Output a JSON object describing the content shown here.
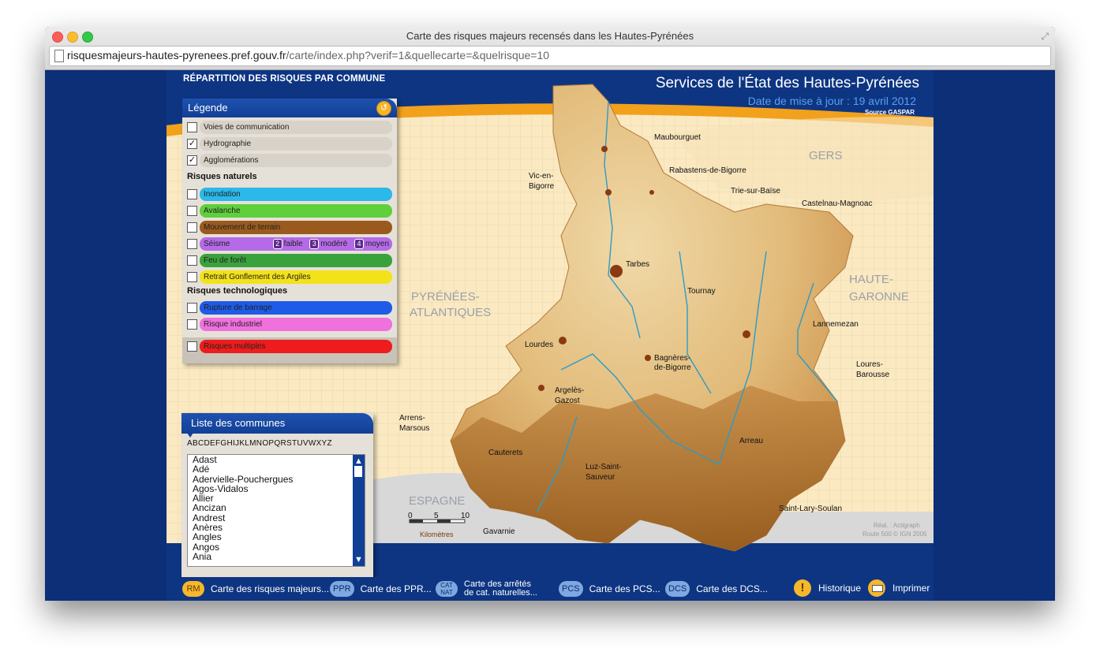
{
  "window": {
    "title": "Carte des risques majeurs recensés dans les Hautes-Pyrénées",
    "url_host": "risquesmajeurs-hautes-pyrenees.pref.gouv.fr",
    "url_path": "/carte/index.php?verif=1&quellecarte=&quelrisque=10"
  },
  "header": {
    "repartition": "RÉPARTITION DES RISQUES PAR COMMUNE",
    "services": "Services de l'État des Hautes-Pyrénées",
    "mise_a_jour": "Date de mise à jour : 19 avril 2012",
    "source": "Source GASPAR"
  },
  "legend": {
    "title": "Légende",
    "reset_icon": "refresh-icon",
    "base_layers": [
      {
        "label": "Voies de communication",
        "checked": false
      },
      {
        "label": "Hydrographie",
        "checked": true
      },
      {
        "label": "Agglomérations",
        "checked": true
      }
    ],
    "natural_title": "Risques naturels",
    "natural": [
      {
        "label": "Inondation",
        "color": "#2bb8ea"
      },
      {
        "label": "Avalanche",
        "color": "#5fcf3c"
      },
      {
        "label": "Mouvement de terrain",
        "color": "#9a5a1e"
      },
      {
        "label": "Séisme",
        "color": "#b56ae8"
      },
      {
        "label": "Feu de forêt",
        "color": "#3aa23c"
      },
      {
        "label": "Retrait Gonflement des Argiles",
        "color": "#f2e21a"
      }
    ],
    "seisme_levels": [
      {
        "num": "2",
        "label": "faible"
      },
      {
        "num": "3",
        "label": "modéré"
      },
      {
        "num": "4",
        "label": "moyen"
      }
    ],
    "tech_title": "Risques technologiques",
    "tech": [
      {
        "label": "Rupture de barrage",
        "color": "#1f5be8"
      },
      {
        "label": "Risque industriel",
        "color": "#f070de"
      }
    ],
    "multiple": {
      "label": "Risques multiples",
      "color": "#ee1c1c"
    }
  },
  "communes": {
    "title": "Liste des communes",
    "alphabet": "ABCDEFGHIJKLMNOPQRSTUVWXYZ",
    "items": [
      "Adast",
      "Adé",
      "Adervielle-Pouchergues",
      "Agos-Vidalos",
      "Allier",
      "Ancizan",
      "Andrest",
      "Anères",
      "Angles",
      "Angos",
      "Ania"
    ]
  },
  "map": {
    "regions": {
      "gers": "GERS",
      "pa_1": "PYRÉNÉES-",
      "pa_2": "ATLANTIQUES",
      "hg_1": "HAUTE-",
      "hg_2": "GARONNE",
      "espagne": "ESPAGNE"
    },
    "towns": [
      "Maubourguet",
      "Rabastens-de-Bigorre",
      "Vic-en-",
      "Bigorre",
      "Trie-sur-Baïse",
      "Castelnau-Magnoac",
      "Tarbes",
      "Tournay",
      "Lannemezan",
      "Lourdes",
      "Bagnères-",
      "de-Bigorre",
      "Loures-",
      "Barousse",
      "Argelès-",
      "Gazost",
      "Arrens-",
      "Marsous",
      "Arreau",
      "Cauterets",
      "Luz-Saint-",
      "Sauveur",
      "Saint-Lary-Soulan",
      "Gavarnie"
    ],
    "scale": {
      "t0": "0",
      "t5": "5",
      "t10": "10",
      "unit": "Kilomètres"
    },
    "credit_1": "Réal. : Actigraph",
    "credit_2": "Route 500 © IGN 2005"
  },
  "bottombar": {
    "rm_badge": "RM",
    "rm_label": "Carte des risques majeurs...",
    "ppr_badge": "PPR",
    "ppr_label": "Carte des PPR...",
    "cat_badge": "CAT NAT",
    "cat_label_1": "Carte des arrêtés",
    "cat_label_2": "de cat. naturelles...",
    "pcs_badge": "PCS",
    "pcs_label": "Carte des PCS...",
    "dcs_badge": "DCS",
    "dcs_label": "Carte des DCS...",
    "historique_icon": "warning-icon",
    "historique": "Historique",
    "imprimer_icon": "printer-icon",
    "imprimer": "Imprimer"
  }
}
